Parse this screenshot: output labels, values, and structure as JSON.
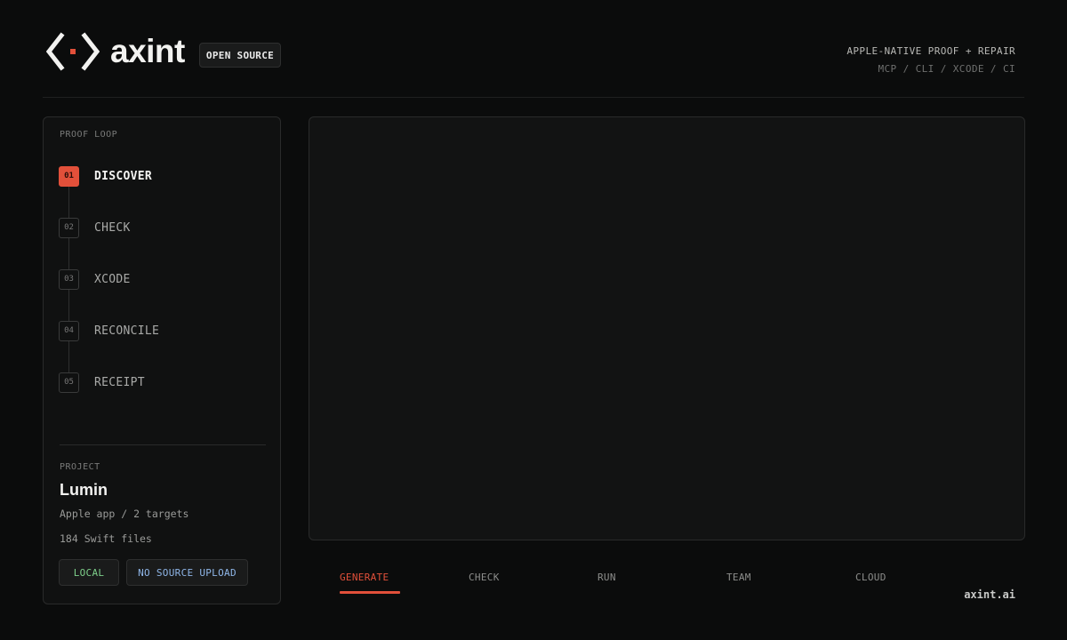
{
  "header": {
    "brand": "axint",
    "badge": "OPEN SOURCE",
    "tagline": "APPLE-NATIVE PROOF + REPAIR",
    "channels": "MCP / CLI / XCODE / CI"
  },
  "sidebar": {
    "section_label": "PROOF LOOP",
    "steps": [
      {
        "num": "01",
        "label": "DISCOVER",
        "active": true
      },
      {
        "num": "02",
        "label": "CHECK",
        "active": false
      },
      {
        "num": "03",
        "label": "XCODE",
        "active": false
      },
      {
        "num": "04",
        "label": "RECONCILE",
        "active": false
      },
      {
        "num": "05",
        "label": "RECEIPT",
        "active": false
      }
    ],
    "project": {
      "label": "PROJECT",
      "name": "Lumin",
      "meta1": "Apple app / 2 targets",
      "meta2": "184 Swift files",
      "chip_local": "LOCAL",
      "chip_upload": "NO SOURCE UPLOAD"
    }
  },
  "tabs": [
    {
      "label": "GENERATE",
      "active": true
    },
    {
      "label": "CHECK",
      "active": false
    },
    {
      "label": "RUN",
      "active": false
    },
    {
      "label": "TEAM",
      "active": false
    },
    {
      "label": "CLOUD",
      "active": false
    }
  ],
  "footer": {
    "site": "axint.ai"
  },
  "colors": {
    "accent": "#e2503a",
    "background": "#0b0c0c",
    "local": "#7ed08b",
    "upload": "#8fb6e8"
  }
}
